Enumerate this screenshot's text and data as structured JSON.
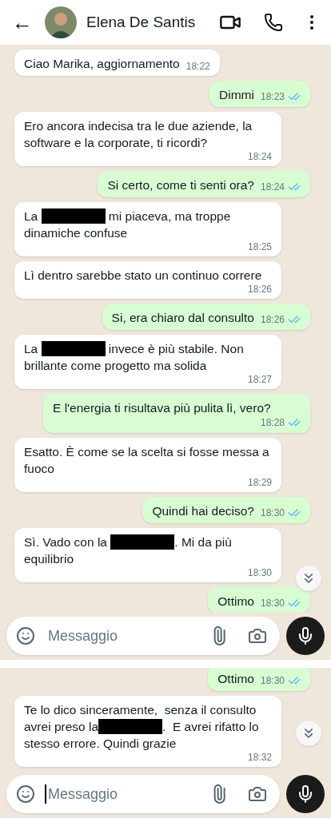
{
  "header": {
    "back": "←",
    "name": "Elena De Santis"
  },
  "panels": [
    {
      "clipped_top": false,
      "scroll_down_button": true,
      "input": {
        "placeholder": "Messaggio",
        "focused": false
      },
      "messages": [
        {
          "kind": "incoming",
          "parts": [
            {
              "kind": "text",
              "text": "Ciao Marika, aggiornamento"
            }
          ],
          "time": "18:22"
        },
        {
          "kind": "outgoing",
          "parts": [
            {
              "kind": "text",
              "text": "Dimmi"
            }
          ],
          "time": "18:23",
          "read": true
        },
        {
          "kind": "incoming",
          "parts": [
            {
              "kind": "text",
              "text": "Ero ancora indecisa tra le due aziende, la software e la corporate, ti ricordi?"
            }
          ],
          "time": "18:24"
        },
        {
          "kind": "outgoing",
          "parts": [
            {
              "kind": "text",
              "text": "Si certo, come ti senti ora?"
            }
          ],
          "time": "18:24",
          "read": true
        },
        {
          "kind": "incoming",
          "parts": [
            {
              "kind": "text",
              "text": "La "
            },
            {
              "kind": "redacted"
            },
            {
              "kind": "text",
              "text": " mi piaceva, ma troppe dinamiche confuse"
            }
          ],
          "time": "18:25"
        },
        {
          "kind": "incoming",
          "parts": [
            {
              "kind": "text",
              "text": "Lì dentro sarebbe stato un continuo correre"
            }
          ],
          "time": "18:26"
        },
        {
          "kind": "outgoing",
          "parts": [
            {
              "kind": "text",
              "text": "Si, era chiaro dal consulto"
            }
          ],
          "time": "18:26",
          "read": true
        },
        {
          "kind": "incoming",
          "parts": [
            {
              "kind": "text",
              "text": "La "
            },
            {
              "kind": "redacted"
            },
            {
              "kind": "text",
              "text": " invece è più stabile. Non brillante come progetto ma solida"
            }
          ],
          "time": "18:27"
        },
        {
          "kind": "outgoing",
          "parts": [
            {
              "kind": "text",
              "text": "E l'energia ti risultava più pulita lì, vero?"
            }
          ],
          "time": "18:28",
          "read": true
        },
        {
          "kind": "incoming",
          "parts": [
            {
              "kind": "text",
              "text": "Esatto. È come se la scelta si fosse messa a fuoco"
            }
          ],
          "time": "18:29"
        },
        {
          "kind": "outgoing",
          "parts": [
            {
              "kind": "text",
              "text": "Quindi hai deciso?"
            }
          ],
          "time": "18:30",
          "read": true
        },
        {
          "kind": "incoming",
          "parts": [
            {
              "kind": "text",
              "text": "Sì. Vado con la "
            },
            {
              "kind": "redacted"
            },
            {
              "kind": "text",
              "text": ". Mi da più equilibrio"
            }
          ],
          "time": "18:30"
        },
        {
          "kind": "outgoing",
          "parts": [
            {
              "kind": "text",
              "text": "Ottimo"
            }
          ],
          "time": "18:30",
          "read": true
        }
      ]
    },
    {
      "clipped_top": true,
      "scroll_down_button": true,
      "input": {
        "placeholder": "Messaggio",
        "focused": true
      },
      "messages": [
        {
          "kind": "outgoing",
          "parts": [
            {
              "kind": "text",
              "text": "Ottimo"
            }
          ],
          "time": "18:30",
          "read": true
        },
        {
          "kind": "incoming",
          "parts": [
            {
              "kind": "text",
              "text": "Te lo dico sinceramente,  senza il consulto avrei preso la"
            },
            {
              "kind": "redacted"
            },
            {
              "kind": "text",
              "text": ".  E avrei rifatto lo stesso errore. Quindi grazie"
            }
          ],
          "time": "18:32"
        }
      ]
    }
  ]
}
